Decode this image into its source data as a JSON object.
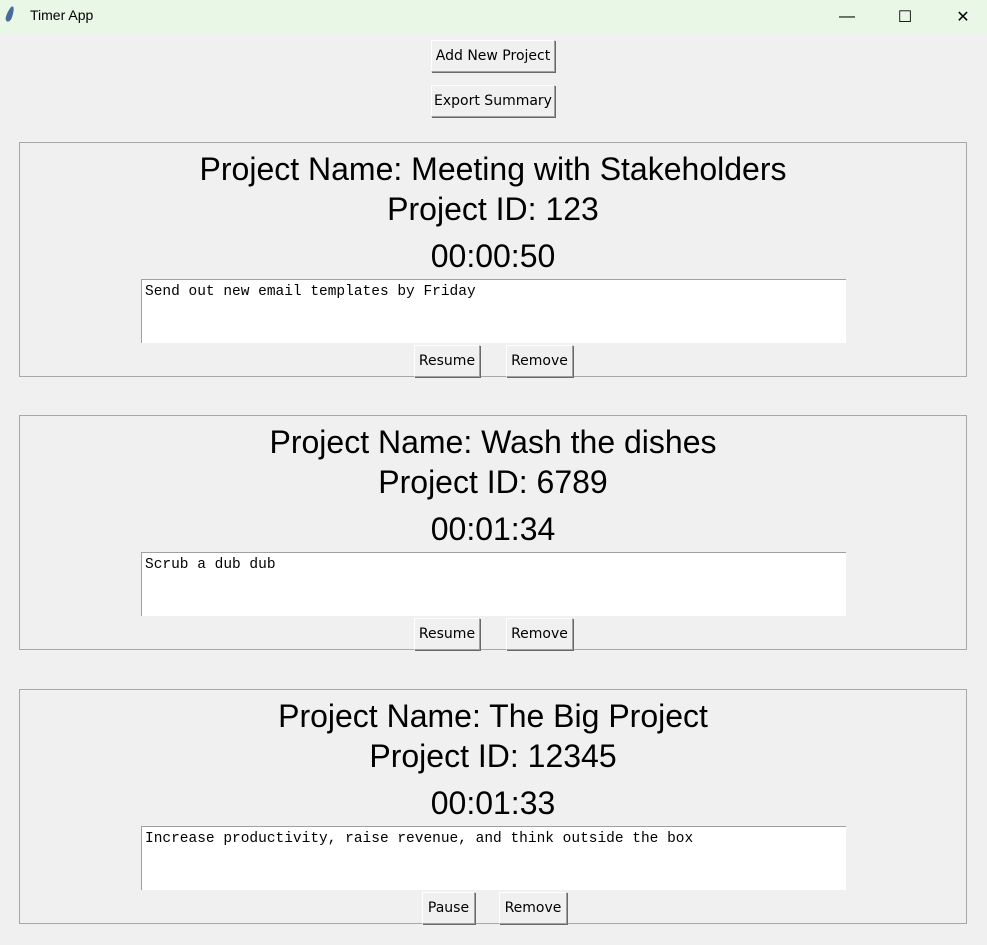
{
  "window": {
    "title": "Timer App",
    "minimize": "—",
    "maximize": "☐",
    "close": "✕"
  },
  "toolbar": {
    "add_label": "Add New Project",
    "export_label": "Export Summary"
  },
  "projects": [
    {
      "name": "Project Name: Meeting with Stakeholders",
      "id": "Project ID: 123",
      "time": "00:00:50",
      "notes": "Send out new email templates by Friday",
      "toggle_label": "Resume",
      "remove_label": "Remove"
    },
    {
      "name": "Project Name: Wash the dishes",
      "id": "Project ID: 6789",
      "time": "00:01:34",
      "notes": "Scrub a dub dub",
      "toggle_label": "Resume",
      "remove_label": "Remove"
    },
    {
      "name": "Project Name: The Big Project",
      "id": "Project ID: 12345",
      "time": "00:01:33",
      "notes": "Increase productivity, raise revenue, and think outside the box",
      "toggle_label": "Pause",
      "remove_label": "Remove"
    }
  ]
}
